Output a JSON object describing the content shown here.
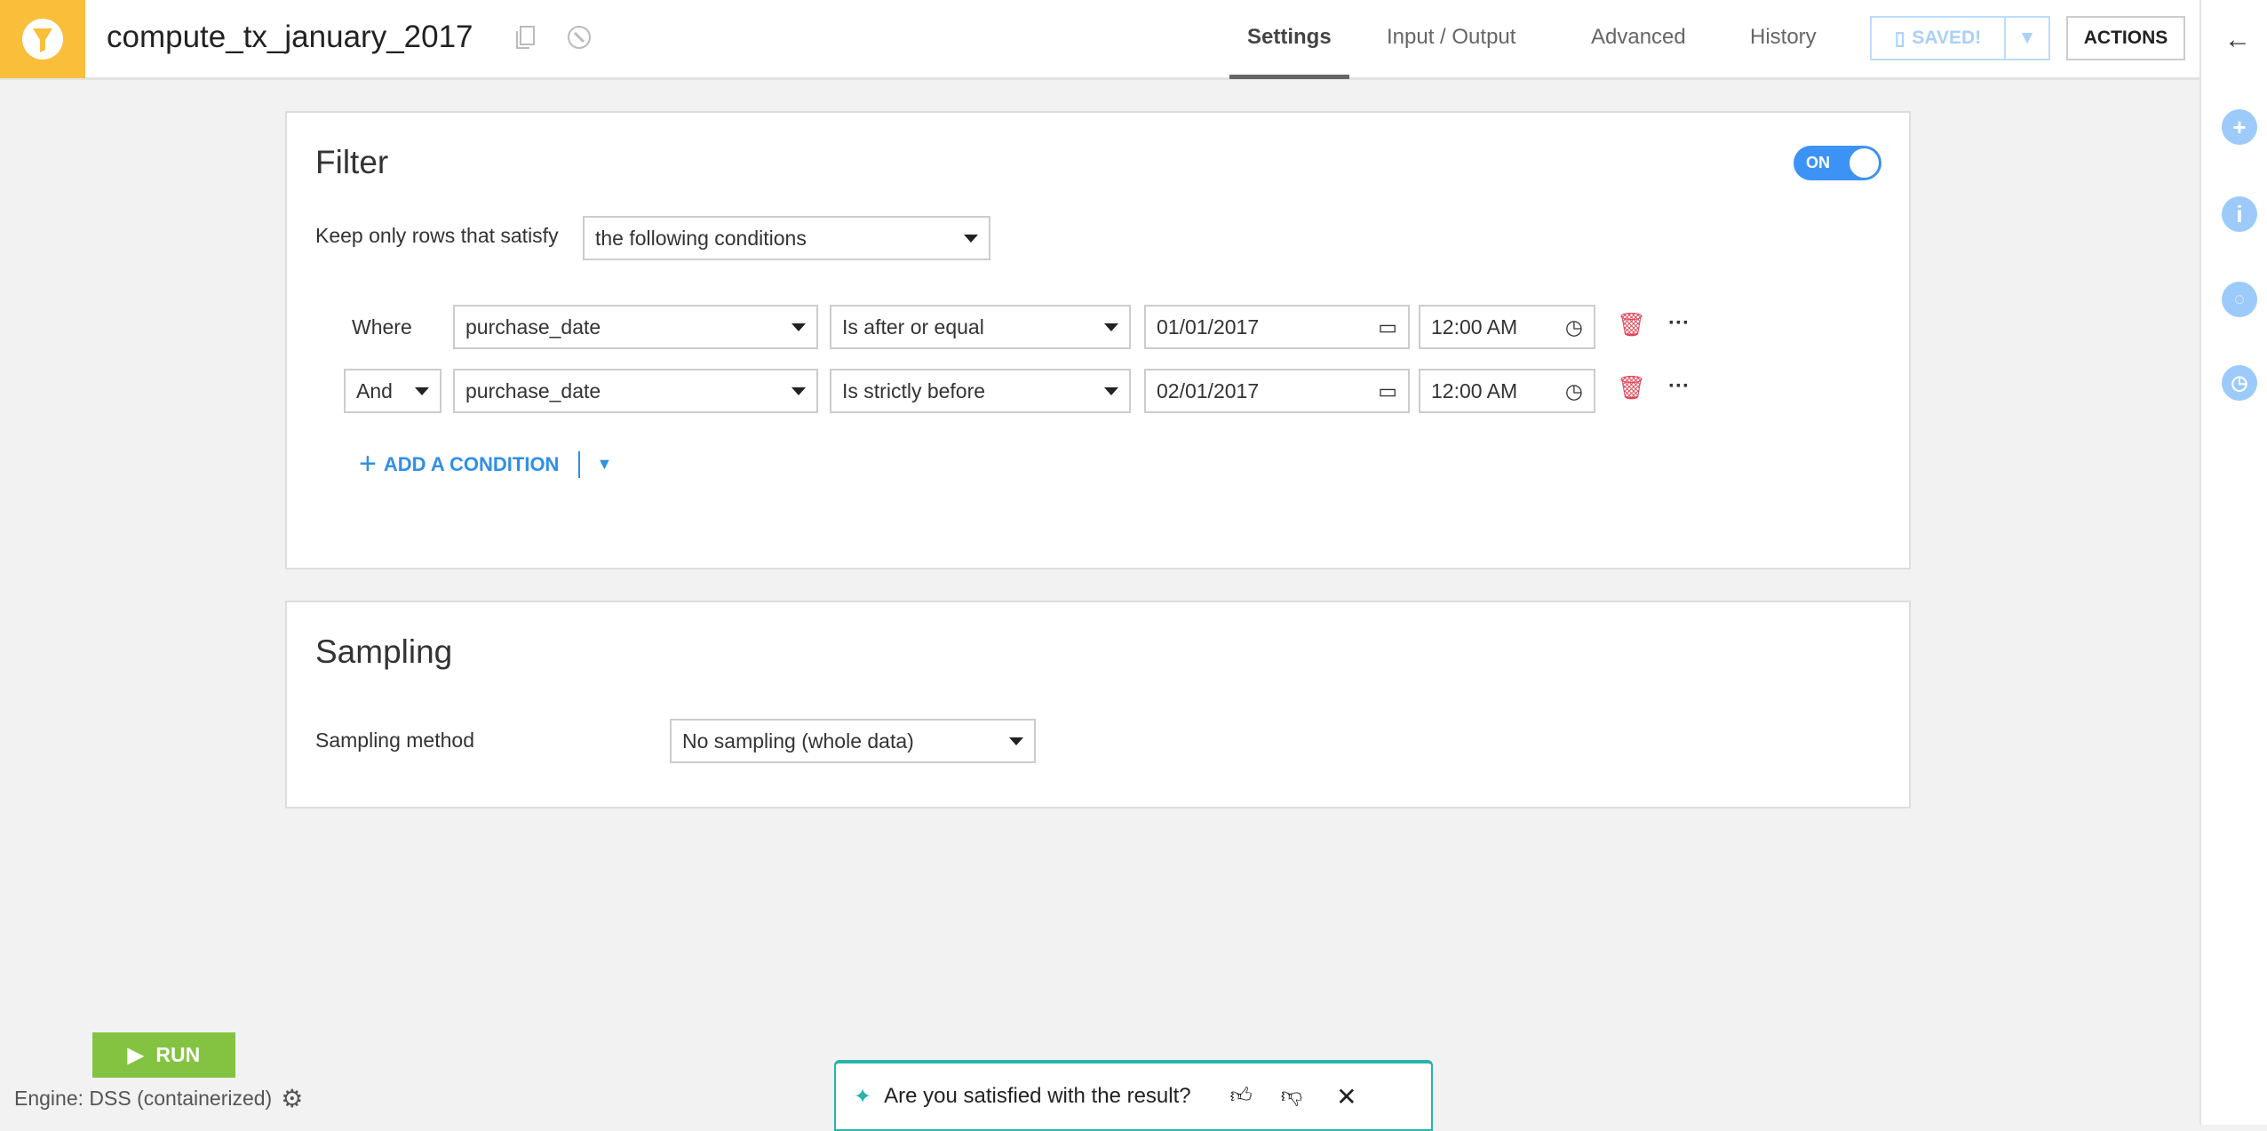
{
  "header": {
    "title": "compute_tx_january_2017",
    "tabs": [
      "Settings",
      "Input / Output",
      "Advanced",
      "History"
    ],
    "saved_label": "SAVED!",
    "actions_label": "ACTIONS"
  },
  "filter": {
    "title": "Filter",
    "toggle": "ON",
    "keep_label": "Keep only rows that satisfy",
    "mode": "the following conditions",
    "conditions": [
      {
        "connector": "Where",
        "column": "purchase_date",
        "operator": "Is after or equal",
        "date": "01/01/2017",
        "time": "12:00 AM"
      },
      {
        "connector": "And",
        "column": "purchase_date",
        "operator": "Is strictly before",
        "date": "02/01/2017",
        "time": "12:00 AM"
      }
    ],
    "add_label": "ADD A CONDITION"
  },
  "sampling": {
    "title": "Sampling",
    "method_label": "Sampling method",
    "method": "No sampling (whole data)"
  },
  "run_label": "RUN",
  "engine": "Engine: DSS (containerized)",
  "feedback": {
    "question": "Are you satisfied with the result?"
  },
  "colors": {
    "accent": "#3d93f5",
    "recipe": "#f9be3a",
    "run": "#84c341",
    "feedback": "#2ab3a8"
  }
}
